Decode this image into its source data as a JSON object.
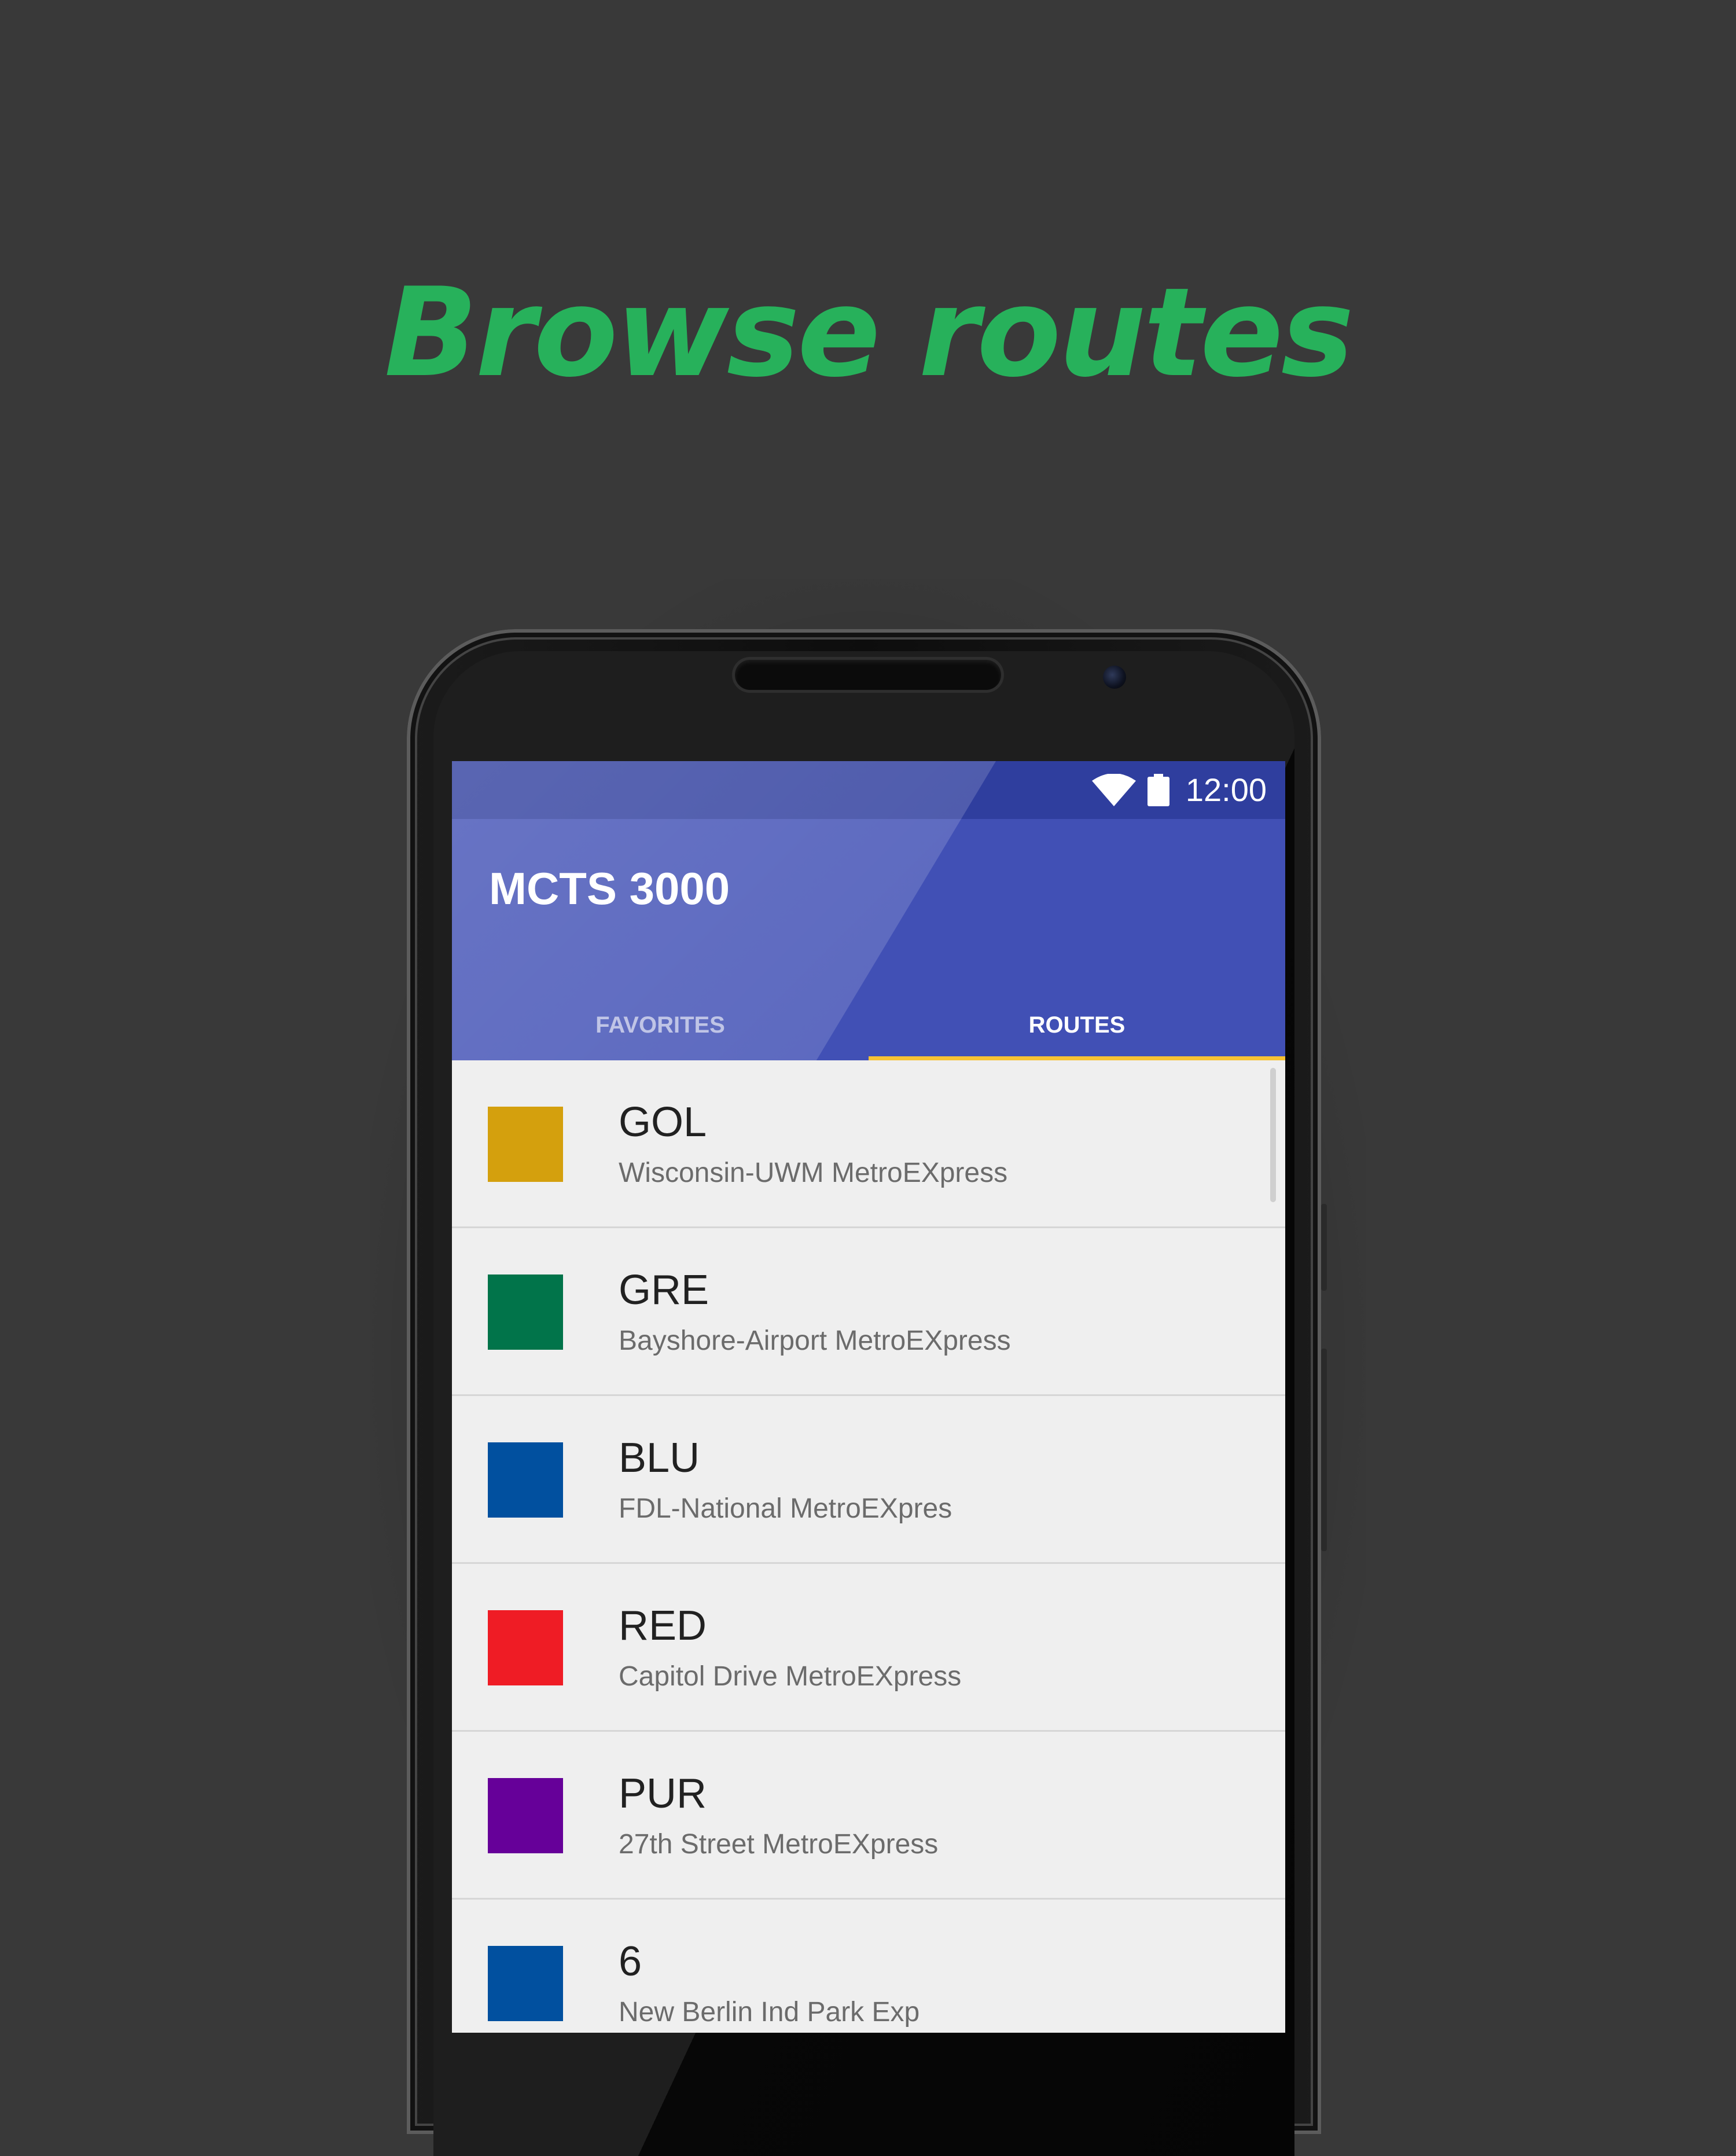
{
  "promo": {
    "headline": "Browse routes",
    "headline_color": "#27b15b"
  },
  "status_bar": {
    "wifi_icon": "wifi-icon",
    "battery_icon": "battery-icon",
    "time": "12:00"
  },
  "app": {
    "title": "MCTS 3000",
    "primary_color": "#4150b5",
    "status_color": "#2f3e9e",
    "accent_color": "#f7c234"
  },
  "tabs": [
    {
      "label": "FAVORITES",
      "selected": false
    },
    {
      "label": "ROUTES",
      "selected": true
    }
  ],
  "routes": [
    {
      "code": "GOL",
      "description": "Wisconsin-UWM MetroEXpress",
      "color": "#d4a00d"
    },
    {
      "code": "GRE",
      "description": "Bayshore-Airport MetroEXpress",
      "color": "#01744a"
    },
    {
      "code": "BLU",
      "description": "FDL-National MetroEXpres",
      "color": "#01509f"
    },
    {
      "code": "RED",
      "description": "Capitol Drive MetroEXpress",
      "color": "#ef1c25"
    },
    {
      "code": "PUR",
      "description": "27th Street MetroEXpress",
      "color": "#660099"
    },
    {
      "code": "6",
      "description": "New Berlin Ind Park Exp",
      "color": "#01509f"
    }
  ]
}
